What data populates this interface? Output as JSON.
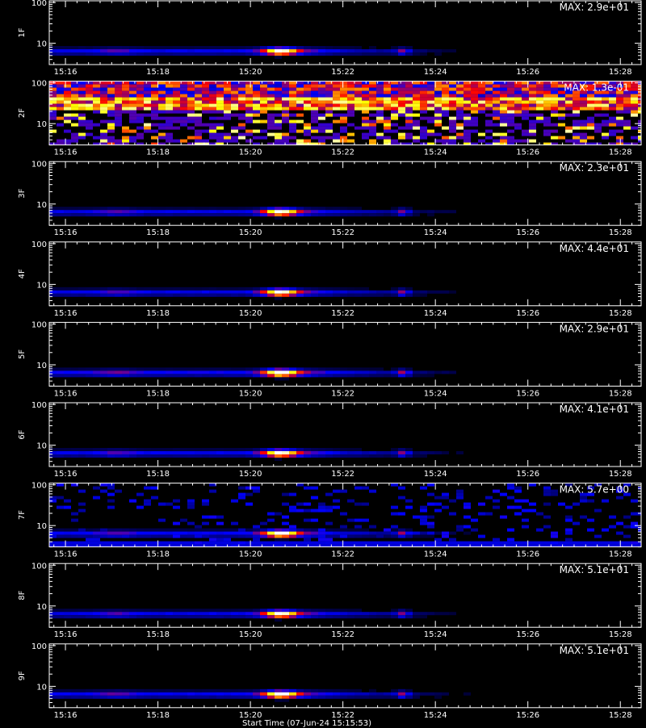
{
  "chart_data": {
    "type": "heatmap",
    "description_note": "",
    "x_tick_labels": [
      "15:16",
      "15:18",
      "15:20",
      "15:22",
      "15:24",
      "15:26",
      "15:28"
    ],
    "x_tick_minutes": [
      16,
      18,
      20,
      22,
      24,
      26,
      28
    ],
    "xlim_minutes": [
      15.65,
      28.45
    ],
    "y_scale": "log",
    "ylim": [
      3,
      110
    ],
    "y_tick_labels": [
      "10",
      "100"
    ],
    "colormap": [
      "#000000",
      "#0000ff",
      "#ff0000",
      "#ffff00",
      "#ffffff"
    ],
    "panels": [
      {
        "label": "1F",
        "max_text": "MAX: 2.9e+01",
        "pattern": "burst",
        "intensity": 0.85
      },
      {
        "label": "2F",
        "max_text": "MAX: 1.3e-01",
        "pattern": "noise",
        "intensity": 1.0
      },
      {
        "label": "3F",
        "max_text": "MAX: 2.3e+01",
        "pattern": "burst",
        "intensity": 0.85
      },
      {
        "label": "4F",
        "max_text": "MAX: 4.4e+01",
        "pattern": "burst",
        "intensity": 0.85
      },
      {
        "label": "5F",
        "max_text": "MAX: 2.9e+01",
        "pattern": "burst",
        "intensity": 0.95
      },
      {
        "label": "6F",
        "max_text": "MAX: 4.1e+01",
        "pattern": "burst",
        "intensity": 0.85
      },
      {
        "label": "7F",
        "max_text": "MAX: 5.7e+00",
        "pattern": "burst_noisy",
        "intensity": 0.9
      },
      {
        "label": "8F",
        "max_text": "MAX: 5.1e+01",
        "pattern": "burst",
        "intensity": 0.85
      },
      {
        "label": "9F",
        "max_text": "MAX: 5.1e+01",
        "pattern": "burst",
        "intensity": 0.9
      }
    ],
    "x_axis_title": "Start Time (07-Jun-24 15:15:53)"
  }
}
